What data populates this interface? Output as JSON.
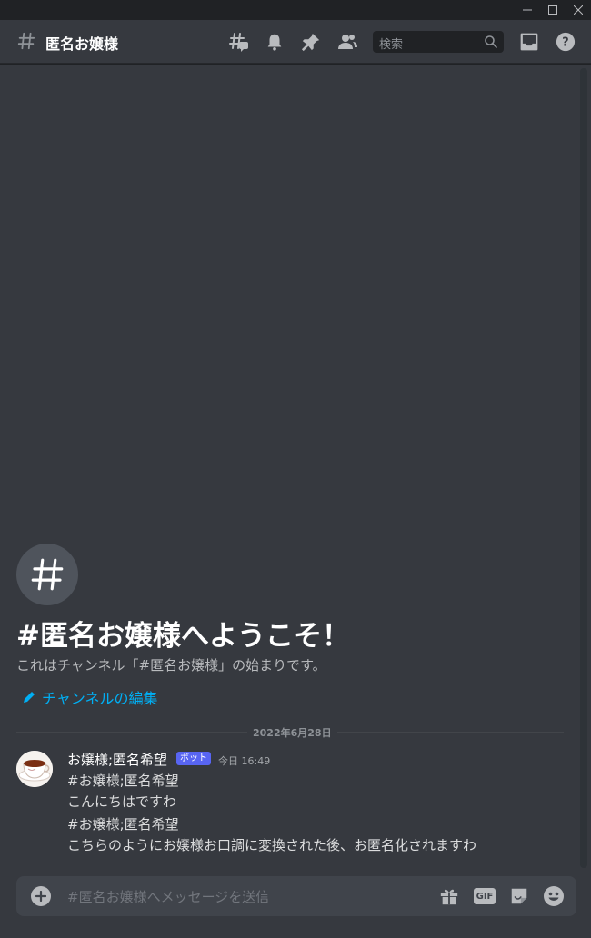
{
  "channel": {
    "name": "匿名お嬢様"
  },
  "search": {
    "placeholder": "検索"
  },
  "welcome": {
    "title": "#匿名お嬢様へようこそ！",
    "description": "これはチャンネル「#匿名お嬢様」の始まりです。",
    "edit_link": "チャンネルの編集"
  },
  "messages": {
    "date_divider": "2022年6月28日",
    "items": [
      {
        "author": "お嬢様;匿名希望",
        "tag": "ボット",
        "time": "今日 16:49",
        "lines": [
          "#お嬢様;匿名希望",
          "こんにちはですわ",
          "#お嬢様;匿名希望",
          "こちらのようにお嬢様お口調に変換された後、お匿名化されますわ"
        ]
      }
    ]
  },
  "composer": {
    "placeholder": "#匿名お嬢様へメッセージを送信",
    "gif_label": "GIF"
  },
  "colors": {
    "background": "#36393f",
    "titlebar": "#202225",
    "link": "#00aff4",
    "bot_tag": "#5865f2",
    "composer": "#40444b"
  },
  "icons": {
    "header": [
      "hash-icon",
      "threads-icon",
      "bell-icon",
      "pin-icon",
      "members-icon",
      "search-icon",
      "inbox-icon",
      "help-icon"
    ],
    "composer": [
      "plus-icon",
      "gift-icon",
      "gif-icon",
      "sticker-icon",
      "emoji-icon"
    ],
    "window": [
      "minimize-icon",
      "maximize-icon",
      "close-icon"
    ]
  }
}
